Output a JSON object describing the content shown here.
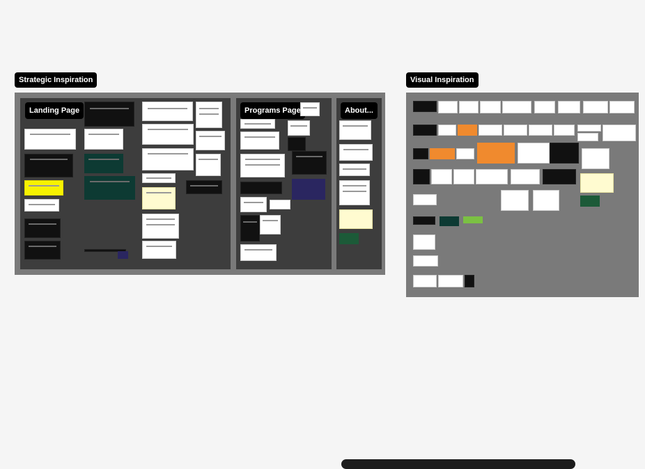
{
  "canvas": {
    "strategic": {
      "title": "Strategic Inspiration",
      "sections": {
        "landing": "Landing Page",
        "programs": "Programs Page",
        "about": "About..."
      }
    },
    "visual": {
      "title": "Visual Inspiration"
    }
  },
  "colors": {
    "background": "#f5f5f5",
    "frame": "#7a7a7a",
    "section": "#3d3d3d",
    "label_bg": "#000000",
    "label_text": "#ffffff"
  }
}
